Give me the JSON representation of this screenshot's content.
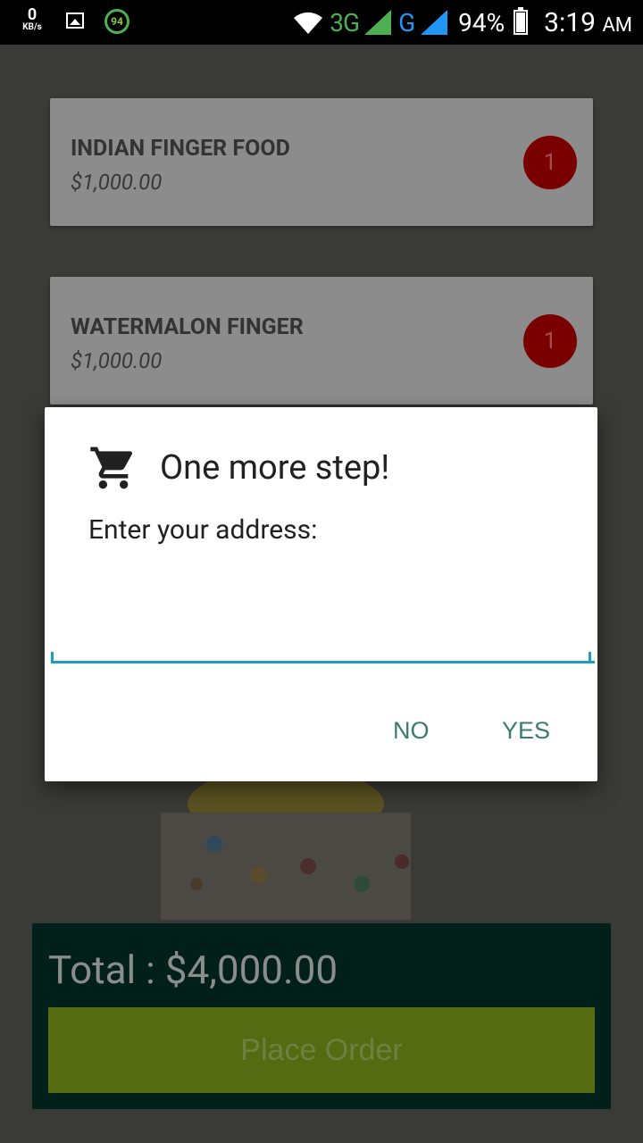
{
  "status_bar": {
    "speed_value": "0",
    "speed_unit": "KB/s",
    "badge_number": "94",
    "network_3g": "3G",
    "network_g": "G",
    "battery_percent": "94%",
    "time": "3:19",
    "time_suffix": "AM"
  },
  "cart": {
    "items": [
      {
        "name": "INDIAN FINGER FOOD",
        "price": "$1,000.00",
        "quantity": "1"
      },
      {
        "name": "WATERMALON FINGER",
        "price": "$1,000.00",
        "quantity": "1"
      }
    ]
  },
  "footer": {
    "total": "Total : $4,000.00",
    "place_order_label": "Place Order"
  },
  "dialog": {
    "icon": "shopping-cart-icon",
    "title": "One more step!",
    "message": "Enter your address:",
    "address_value": "",
    "no_label": "NO",
    "yes_label": "YES"
  },
  "colors": {
    "accent": "#1e9ec0",
    "dialog_button": "#3d7a72",
    "badge": "#b00000",
    "place_order": "#8bc34a",
    "footer_bg": "#043a2e"
  }
}
